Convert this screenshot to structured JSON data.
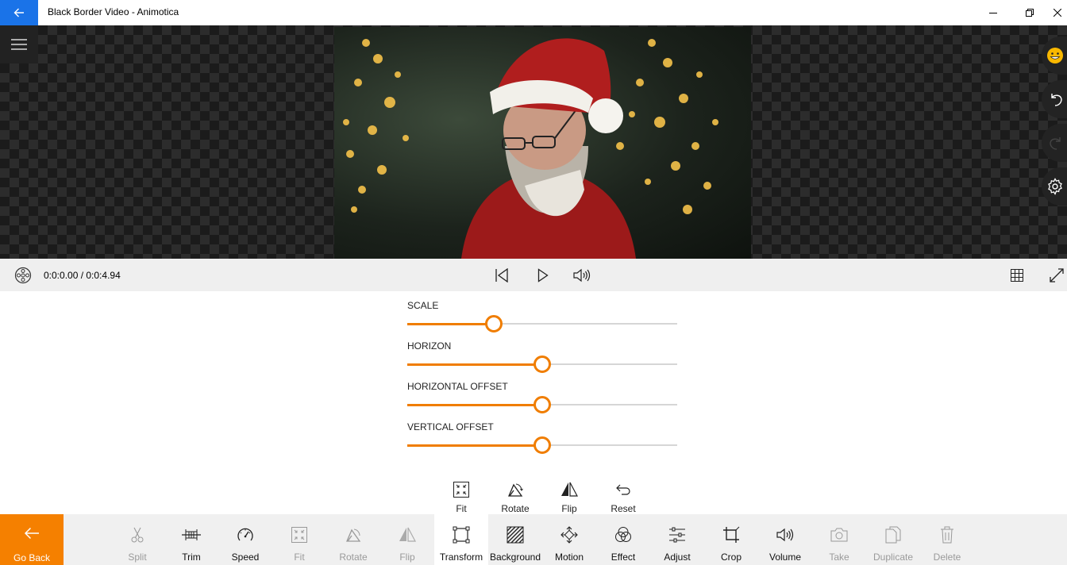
{
  "window": {
    "title": "Black Border Video - Animotica"
  },
  "playback": {
    "time": "0:0:0.00 / 0:0:4.94"
  },
  "sliders": [
    {
      "label": "SCALE",
      "value": 0.32
    },
    {
      "label": "HORIZON",
      "value": 0.5
    },
    {
      "label": "HORIZONTAL OFFSET",
      "value": 0.5
    },
    {
      "label": "VERTICAL OFFSET",
      "value": 0.5
    }
  ],
  "subtools": [
    {
      "label": "Fit",
      "icon": "fit-icon"
    },
    {
      "label": "Rotate",
      "icon": "rotate-icon"
    },
    {
      "label": "Flip",
      "icon": "flip-icon"
    },
    {
      "label": "Reset",
      "icon": "reset-icon"
    }
  ],
  "toolbar": {
    "go_back": "Go Back",
    "tools": [
      {
        "label": "Split",
        "icon": "scissors-icon",
        "enabled": false
      },
      {
        "label": "Trim",
        "icon": "trim-icon",
        "enabled": true
      },
      {
        "label": "Speed",
        "icon": "speedometer-icon",
        "enabled": true
      },
      {
        "label": "Fit",
        "icon": "fit-icon",
        "enabled": false
      },
      {
        "label": "Rotate",
        "icon": "rotate-icon",
        "enabled": false
      },
      {
        "label": "Flip",
        "icon": "flip-icon",
        "enabled": false
      },
      {
        "label": "Transform",
        "icon": "transform-icon",
        "enabled": true,
        "active": true
      },
      {
        "label": "Background",
        "icon": "background-icon",
        "enabled": true
      },
      {
        "label": "Motion",
        "icon": "motion-icon",
        "enabled": true
      },
      {
        "label": "Effect",
        "icon": "effect-icon",
        "enabled": true
      },
      {
        "label": "Adjust",
        "icon": "adjust-icon",
        "enabled": true
      },
      {
        "label": "Crop",
        "icon": "crop-icon",
        "enabled": true
      },
      {
        "label": "Volume",
        "icon": "volume-icon",
        "enabled": true
      },
      {
        "label": "Take",
        "icon": "camera-icon",
        "enabled": false
      },
      {
        "label": "Duplicate",
        "icon": "duplicate-icon",
        "enabled": false
      },
      {
        "label": "Delete",
        "icon": "trash-icon",
        "enabled": false
      }
    ]
  },
  "colors": {
    "accent": "#f58000",
    "titlebar_back": "#1a73e8",
    "slider": "#f07d00"
  }
}
